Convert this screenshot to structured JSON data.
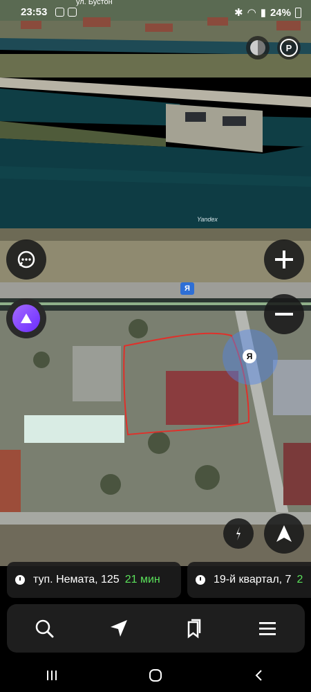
{
  "status_bar": {
    "time": "23:53",
    "battery": "24%"
  },
  "map": {
    "street_label": "ул. Бустон",
    "watermark": "Yandex",
    "user_marker": "Я",
    "transit_sign": "Я"
  },
  "controls": {
    "layers_icon": "layers-icon",
    "parking_label": "P",
    "chat_icon": "chat-icon",
    "zoom_in_icon": "plus-icon",
    "zoom_out_icon": "minus-icon",
    "compass_icon": "compass-icon",
    "location_icon": "navigation-arrow-icon"
  },
  "destinations": [
    {
      "address": "туп. Немата, 125",
      "eta": "21 мин"
    },
    {
      "address": "19-й квартал, 7",
      "eta": "2"
    }
  ],
  "tabbar": {
    "items": [
      "search-icon",
      "navigator-icon",
      "bookmarks-icon",
      "menu-icon"
    ]
  },
  "colors": {
    "accent_green": "#5be25b",
    "alice_purple": "#7c3cff",
    "annotation_red": "#e0302a",
    "water": "#0f3e45"
  }
}
